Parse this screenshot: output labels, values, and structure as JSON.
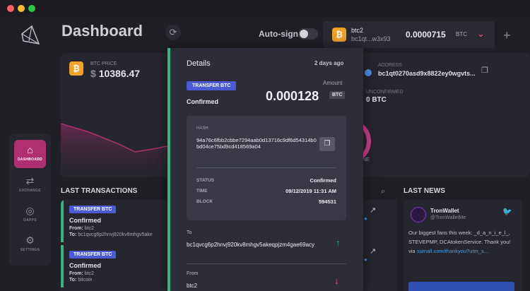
{
  "header": {
    "title": "Dashboard",
    "autosign_label": "Auto-sign",
    "wallet": {
      "name": "btc2",
      "address": "bc1qt...w3x93",
      "balance": "0.0000715",
      "unit": "BTC"
    }
  },
  "sidebar": {
    "items": [
      {
        "label": "DASHBOARD",
        "icon": "home-icon"
      },
      {
        "label": "EXCHANGE",
        "icon": "exchange-icon"
      },
      {
        "label": "DAPPS",
        "icon": "basketball-icon"
      },
      {
        "label": "SETTINGS",
        "icon": "gear-icon"
      }
    ]
  },
  "price_card": {
    "label": "BTC PRICE",
    "value": "10386.47"
  },
  "address_card": {
    "address_label": "ADDRESS",
    "address_value": "bc1qt0270asd9x8822ey0wgvts...",
    "unconfirmed_label": "UNCONFIRMED",
    "unconfirmed_value": "0 BTC",
    "ring_text": "NE"
  },
  "transactions": {
    "title": "LAST TRANSACTIONS",
    "items": [
      {
        "badge": "TRANSFER BTC",
        "status": "Confirmed",
        "from": "btc2",
        "to": "bc1qvcg6p2hnvj920kv8mhgv5ake"
      },
      {
        "badge": "TRANSFER BTC",
        "status": "Confirmed",
        "from": "btc2",
        "to": "bitcoin"
      }
    ]
  },
  "news": {
    "title": "LAST NEWS",
    "name": "TronWallet",
    "handle": "@TronWalletMe",
    "body": "Our biggest fans this week: _d_a_n_i_e_l_, STEVEPMP, DCAtokenService. Thank you! via",
    "link": "sumall.com/thankyou?utm_s..."
  },
  "details": {
    "title": "Details",
    "time": "2 days ago",
    "badge": "TRANSFER BTC",
    "amount_label": "Amount",
    "amount": "0.000128",
    "unit": "BTC",
    "status": "Confirmed",
    "hash_label": "HASH",
    "hash": "94a76c6fbb2cbbe7294aab0d13716c9df6d54314b0bd04ce75bd9cd418569a04",
    "rows": [
      {
        "key": "STATUS",
        "value": "Confirmed"
      },
      {
        "key": "TIME",
        "value": "09/12/2019 11:31 AM"
      },
      {
        "key": "BLOCK",
        "value": "594531"
      }
    ],
    "to_label": "To",
    "to_value": "bc1qvcg6p2hnvj920kv8mhgv5akeqpjzm4gae69acy",
    "from_label": "From",
    "from_value": "btc2"
  }
}
